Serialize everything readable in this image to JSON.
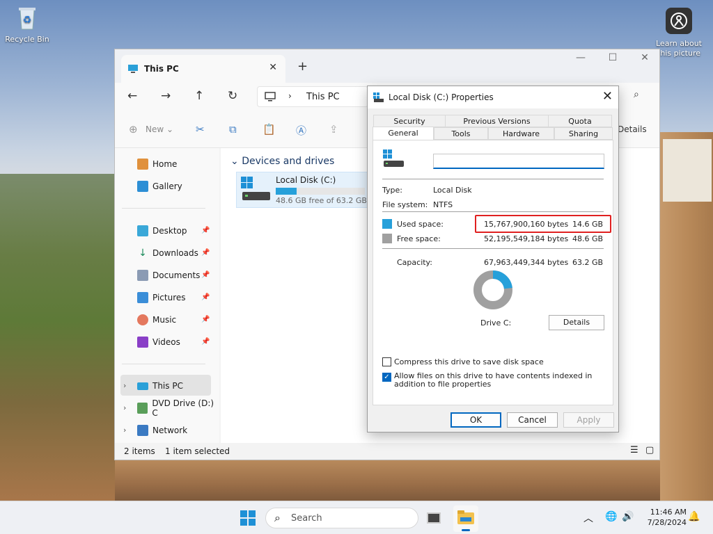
{
  "desktop": {
    "recycle_bin": "Recycle Bin",
    "learn_about": "Learn about this picture"
  },
  "explorer": {
    "tab_title": "This PC",
    "address": "This PC",
    "toolbar": {
      "new_label": "New",
      "details_label": "Details"
    },
    "sidebar": {
      "home": "Home",
      "gallery": "Gallery",
      "desktop": "Desktop",
      "downloads": "Downloads",
      "documents": "Documents",
      "pictures": "Pictures",
      "music": "Music",
      "videos": "Videos",
      "this_pc": "This PC",
      "dvd": "DVD Drive (D:) C",
      "network": "Network"
    },
    "group_header": "Devices and drives",
    "drive": {
      "name": "Local Disk (C:)",
      "free_text": "48.6 GB free of 63.2 GB",
      "used_fraction": 0.231
    },
    "status": {
      "items": "2 items",
      "selected": "1 item selected"
    }
  },
  "dialog": {
    "title": "Local Disk (C:) Properties",
    "tabs_row1": [
      "Security",
      "Previous Versions",
      "Quota"
    ],
    "tabs_row2": [
      "General",
      "Tools",
      "Hardware",
      "Sharing"
    ],
    "name_value": "",
    "type_label": "Type:",
    "type_value": "Local Disk",
    "fs_label": "File system:",
    "fs_value": "NTFS",
    "used_label": "Used space:",
    "used_bytes": "15,767,900,160 bytes",
    "used_gb": "14.6 GB",
    "free_label": "Free space:",
    "free_bytes": "52,195,549,184 bytes",
    "free_gb": "48.6 GB",
    "cap_label": "Capacity:",
    "cap_bytes": "67,963,449,344 bytes",
    "cap_gb": "63.2 GB",
    "drive_label": "Drive C:",
    "details_btn": "Details",
    "compress_label": "Compress this drive to save disk space",
    "compress_checked": false,
    "index_label": "Allow files on this drive to have contents indexed in addition to file properties",
    "index_checked": true,
    "ok": "OK",
    "cancel": "Cancel",
    "apply": "Apply",
    "used_color": "#26a0da",
    "free_color": "#a0a0a0",
    "used_fraction": 0.232
  },
  "taskbar": {
    "search_placeholder": "Search",
    "time": "11:46 AM",
    "date": "7/28/2024"
  }
}
